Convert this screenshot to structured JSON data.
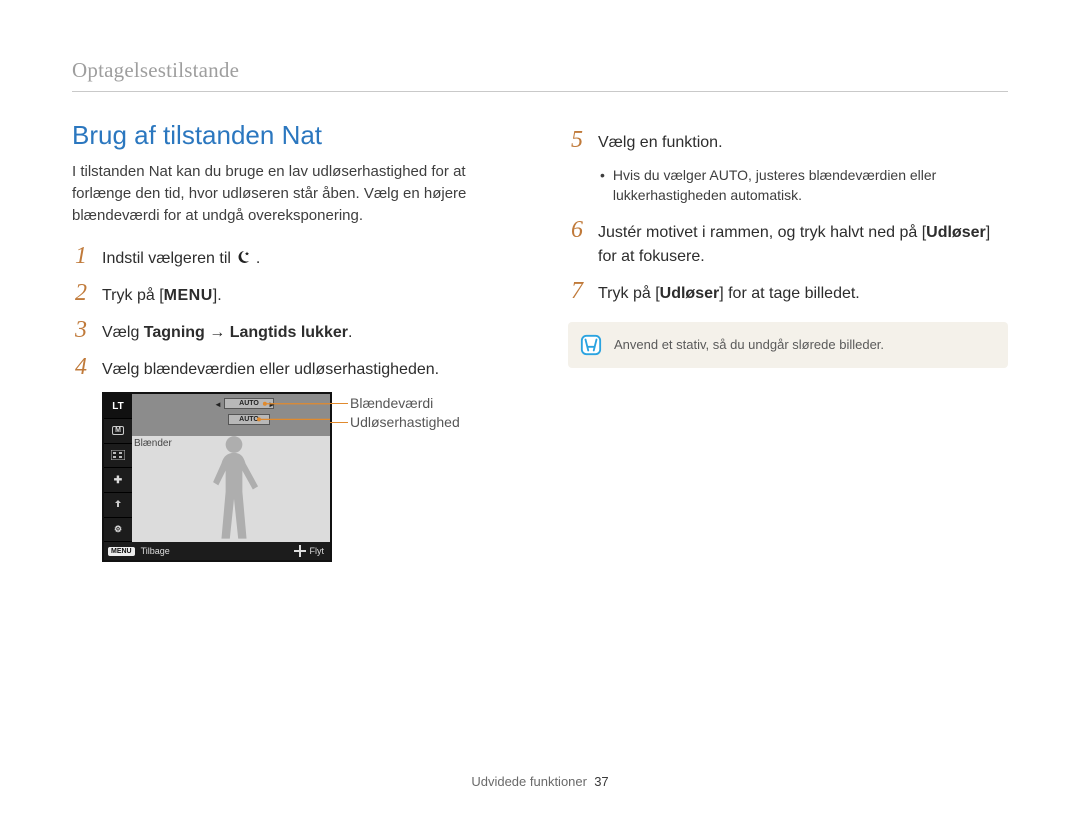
{
  "breadcrumb": "Optagelsestilstande",
  "title": "Brug af tilstanden Nat",
  "intro": "I tilstanden Nat kan du bruge en lav udløserhastighed for at forlænge den tid, hvor udløseren står åben. Vælg en højere blændeværdi for at undgå overeksponering.",
  "left_steps": {
    "s1_pre": "Indstil vælgeren til ",
    "s2_pre": "Tryk på [",
    "s2_menu": "MENU",
    "s2_post": "].",
    "s3_pre": "Vælg ",
    "s3_b1": "Tagning",
    "s3_arrow": " → ",
    "s3_b2": "Langtids lukker",
    "s3_post": ".",
    "s4": "Vælg blændeværdien eller udløserhastigheden."
  },
  "lcd": {
    "lt": "LT",
    "auto1": "AUTO",
    "auto2": "AUTO",
    "blaender": "Blænder",
    "menu": "MENU",
    "back": "Tilbage",
    "move": "Flyt",
    "sidebar_m": "M"
  },
  "callouts": {
    "c1": "Blændeværdi",
    "c2": "Udløserhastighed"
  },
  "right_steps": {
    "s5": "Vælg en funktion.",
    "s5b_pre": "Hvis du vælger ",
    "s5b_auto": "AUTO",
    "s5b_post": ", justeres blændeværdien eller lukkerhastigheden automatisk.",
    "s6_pre": "Justér motivet i rammen, og tryk halvt ned på [",
    "s6_b": "Udløser",
    "s6_post": "] for at fokusere.",
    "s7_pre": "Tryk på [",
    "s7_b": "Udløser",
    "s7_post": "] for at tage billedet."
  },
  "tip": "Anvend et stativ, så du undgår slørede billeder.",
  "footer_label": "Udvidede funktioner",
  "footer_page": "37"
}
